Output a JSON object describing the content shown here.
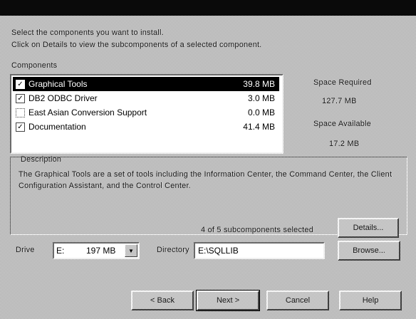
{
  "instructions": {
    "line1": "Select the components you want to install.",
    "line2": "Click on Details to view the subcomponents of a selected component."
  },
  "components": {
    "label": "Components",
    "items": [
      {
        "name": "Graphical Tools",
        "size": "39.8 MB",
        "checked": "✓",
        "selected": true
      },
      {
        "name": "DB2 ODBC Driver",
        "size": "3.0 MB",
        "checked": "✓",
        "selected": false
      },
      {
        "name": "East Asian Conversion Support",
        "size": "0.0 MB",
        "checked": "",
        "selected": false
      },
      {
        "name": "Documentation",
        "size": "41.4 MB",
        "checked": "✓",
        "selected": false
      }
    ]
  },
  "space": {
    "required_label": "Space Required",
    "required_value": "127.7 MB",
    "available_label": "Space Available",
    "available_value": "17.2 MB"
  },
  "description": {
    "label": "Description",
    "text": "The Graphical Tools are a set of tools including the Information Center, the Command Center, the Client Configuration Assistant, and the Control Center.",
    "subcomponents_text": "4 of 5 subcomponents selected",
    "details_button": "Details..."
  },
  "install_location": {
    "drive_label": "Drive",
    "drive_letter": "E:",
    "drive_space": "197 MB",
    "directory_label": "Directory",
    "directory_value": "E:\\SQLLIB",
    "browse_button": "Browse..."
  },
  "nav": {
    "back_button": "< Back",
    "next_button": "Next >",
    "cancel_button": "Cancel",
    "help_button": "Help"
  }
}
